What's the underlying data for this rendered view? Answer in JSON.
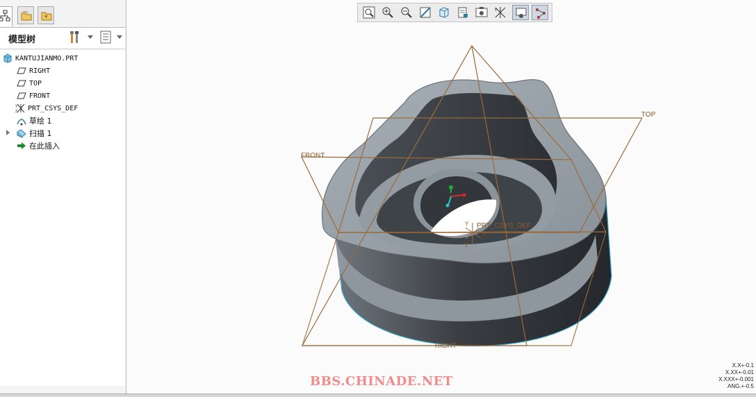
{
  "model_tree": {
    "title": "模型树",
    "items": [
      {
        "label": "KANTUJIANMO.PRT",
        "icon": "part-icon"
      },
      {
        "label": "RIGHT",
        "icon": "datum-plane-icon"
      },
      {
        "label": "TOP",
        "icon": "datum-plane-icon"
      },
      {
        "label": "FRONT",
        "icon": "datum-plane-icon"
      },
      {
        "label": "PRT_CSYS_DEF",
        "icon": "csys-icon"
      },
      {
        "label": "草绘 1",
        "icon": "sketch-icon"
      },
      {
        "label": "扫描 1",
        "icon": "sweep-icon"
      },
      {
        "label": "在此插入",
        "icon": "insert-here-arrow-icon"
      }
    ]
  },
  "toolbar": {
    "buttons": [
      "refit-icon",
      "zoom-in-icon",
      "zoom-out-icon",
      "repaint-icon",
      "display-style-icon",
      "saved-views-icon",
      "view-manager-icon",
      "datum-display-icon",
      "annotation-display-icon",
      "spin-center-icon"
    ]
  },
  "viewport": {
    "labels": {
      "top": "TOP",
      "front": "FRONT",
      "right": "RIGHT",
      "csys": "PRT_CSYS_DEF",
      "axis_x": "X",
      "axis_y": "Y",
      "axis_z": "Z"
    },
    "colors": {
      "datum": "#9a6a3a",
      "body_dark": "#3b3f44",
      "body_light": "#8f979e",
      "edge": "#2fa7c4"
    }
  },
  "watermark": "BBS.CHINADE.NET",
  "tolerance": {
    "lines": [
      "X.X+-0.1",
      "X.XX+-0.01",
      "X.XXX+-0.001",
      "ANG.+-0.5"
    ]
  }
}
